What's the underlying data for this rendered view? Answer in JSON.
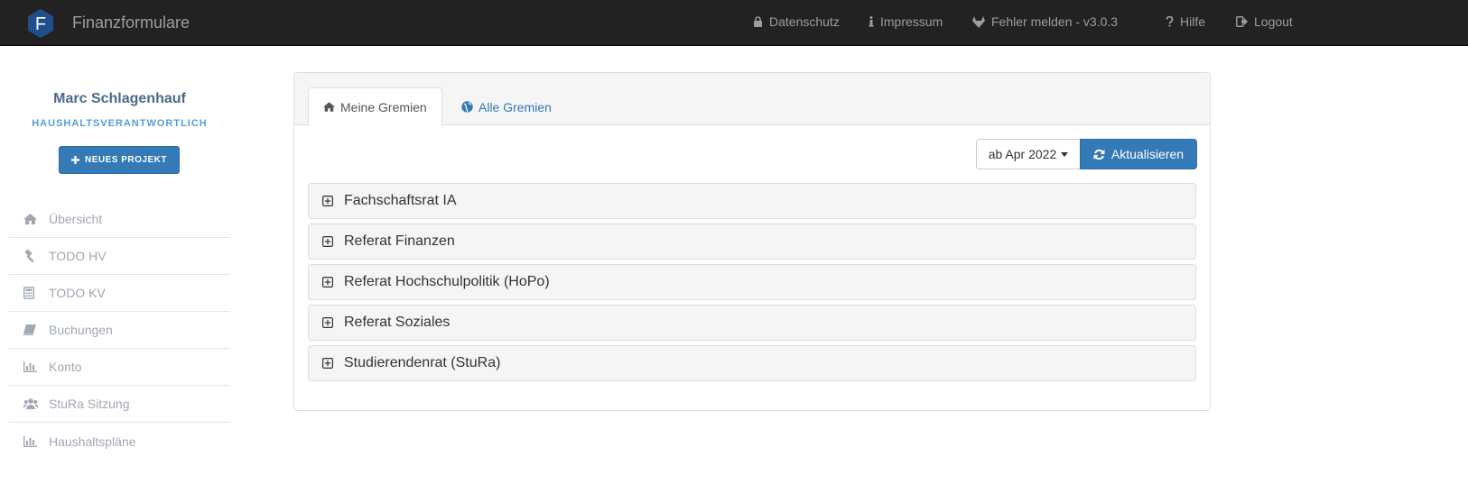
{
  "navbar": {
    "brand_letter": "F",
    "title": "Finanzformulare",
    "items": [
      {
        "label": "Datenschutz",
        "icon": "lock-icon"
      },
      {
        "label": "Impressum",
        "icon": "info-icon"
      },
      {
        "label": "Fehler melden - v3.0.3",
        "icon": "gitlab-icon"
      },
      {
        "label": "Hilfe",
        "icon": "question-icon"
      },
      {
        "label": "Logout",
        "icon": "logout-icon"
      }
    ]
  },
  "user": {
    "name": "Marc Schlagenhauf",
    "role": "HAUSHALTSVERANTWORTLICH"
  },
  "sidebar": {
    "new_project_label": "NEUES PROJEKT",
    "items": [
      {
        "label": "Übersicht",
        "icon": "home-icon"
      },
      {
        "label": "TODO HV",
        "icon": "gavel-icon"
      },
      {
        "label": "TODO KV",
        "icon": "calculator-icon"
      },
      {
        "label": "Buchungen",
        "icon": "book-icon"
      },
      {
        "label": "Konto",
        "icon": "bar-chart-icon"
      },
      {
        "label": "StuRa Sitzung",
        "icon": "users-icon"
      },
      {
        "label": "Haushaltspläne",
        "icon": "bar-chart-icon"
      }
    ]
  },
  "main": {
    "tabs": [
      {
        "label": "Meine Gremien",
        "icon": "home-icon",
        "active": true
      },
      {
        "label": "Alle Gremien",
        "icon": "globe-icon",
        "active": false
      }
    ],
    "date_filter": "ab Apr 2022",
    "refresh_label": "Aktualisieren",
    "groups": [
      "Fachschaftsrat IA",
      "Referat Finanzen",
      "Referat Hochschulpolitik (HoPo)",
      "Referat Soziales",
      "Studierendenrat (StuRa)"
    ]
  },
  "colors": {
    "navbar_bg": "#222222",
    "navbar_text": "#9d9d9d",
    "primary": "#337ab7",
    "user_name": "#4a6a8a",
    "user_role": "#5a9bd5",
    "sidebar_text": "#9fa8b3",
    "panel_bg": "#f5f5f5"
  }
}
